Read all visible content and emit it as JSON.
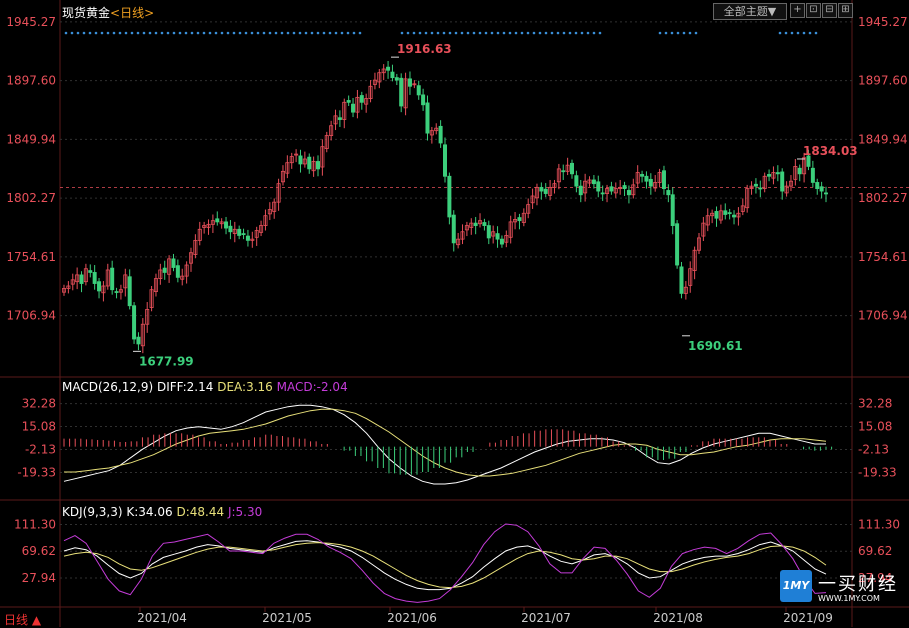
{
  "header": {
    "symbol": "现货黄金",
    "period_tag": "<日线>",
    "theme_button": "全部主题▼"
  },
  "window_buttons": [
    "+",
    "⊡",
    "⊟",
    "⊞"
  ],
  "period_label": "日线 ▲",
  "watermark": {
    "logo_text": "1MY",
    "name": "一买财经",
    "url": "WWW.1MY.COM"
  },
  "colors": {
    "up": "#e8505a",
    "down": "#3ccf7c",
    "axis_text": "#e8505a",
    "grid": "#303030",
    "diff": "#ffffff",
    "dea": "#e8e07a",
    "k": "#ffffff",
    "d": "#e8e07a",
    "j": "#c43cd8"
  },
  "chart_data": [
    {
      "type": "candlestick",
      "title": "现货黄金",
      "yticks": [
        "1945.27",
        "1897.60",
        "1849.94",
        "1802.27",
        "1754.61",
        "1706.94"
      ],
      "ylim": [
        1658,
        1950
      ],
      "xticks": [
        "2021/04",
        "2021/05",
        "2021/06",
        "2021/07",
        "2021/08",
        "2021/09"
      ],
      "annotations": [
        {
          "text": "1916.63",
          "value": 1916.63,
          "type": "high"
        },
        {
          "text": "1677.99",
          "value": 1677.99,
          "type": "low"
        },
        {
          "text": "1690.61",
          "value": 1690.61,
          "type": "low"
        },
        {
          "text": "1834.03",
          "value": 1834.03,
          "type": "high"
        }
      ],
      "reference_line": 1811,
      "closes": [
        1729,
        1731,
        1736,
        1740,
        1733,
        1745,
        1742,
        1733,
        1727,
        1731,
        1744,
        1728,
        1726,
        1728,
        1740,
        1715,
        1688,
        1684,
        1700,
        1712,
        1728,
        1737,
        1744,
        1742,
        1753,
        1746,
        1738,
        1739,
        1748,
        1758,
        1768,
        1777,
        1780,
        1781,
        1784,
        1783,
        1783,
        1778,
        1775,
        1777,
        1772,
        1773,
        1768,
        1769,
        1776,
        1780,
        1788,
        1793,
        1799,
        1814,
        1824,
        1831,
        1836,
        1838,
        1830,
        1834,
        1826,
        1832,
        1826,
        1844,
        1853,
        1861,
        1869,
        1866,
        1880,
        1880,
        1872,
        1884,
        1880,
        1883,
        1893,
        1898,
        1904,
        1907,
        1906,
        1900,
        1898,
        1877,
        1899,
        1893,
        1895,
        1886,
        1878,
        1855,
        1857,
        1859,
        1847,
        1820,
        1787,
        1766,
        1769,
        1775,
        1780,
        1782,
        1780,
        1784,
        1780,
        1770,
        1775,
        1769,
        1765,
        1772,
        1783,
        1785,
        1784,
        1790,
        1797,
        1804,
        1811,
        1808,
        1806,
        1811,
        1814,
        1826,
        1824,
        1829,
        1822,
        1812,
        1805,
        1816,
        1817,
        1814,
        1808,
        1806,
        1810,
        1808,
        1810,
        1811,
        1810,
        1805,
        1813,
        1823,
        1820,
        1816,
        1812,
        1815,
        1823,
        1810,
        1805,
        1780,
        1748,
        1725,
        1730,
        1745,
        1760,
        1770,
        1782,
        1788,
        1790,
        1786,
        1792,
        1789,
        1790,
        1787,
        1790,
        1796,
        1810,
        1812,
        1812,
        1810,
        1820,
        1820,
        1823,
        1822,
        1808,
        1812,
        1816,
        1828,
        1822,
        1835,
        1828,
        1815,
        1810,
        1808,
        1806
      ],
      "highs_marked": [
        1916.63,
        1834.03
      ],
      "lows_marked": [
        1677.99,
        1690.61
      ]
    },
    {
      "type": "line",
      "title": "MACD(26,12,9)",
      "labels": {
        "name": "MACD(26,12,9)",
        "diff": "DIFF:2.14",
        "dea": "DEA:3.16",
        "macd": "MACD:-2.04"
      },
      "yticks": [
        "32.28",
        "15.08",
        "-2.13",
        "-19.33"
      ],
      "ylim": [
        -37,
        38
      ],
      "series": [
        {
          "name": "DIFF",
          "values": [
            -26,
            -24,
            -22,
            -20,
            -18,
            -14,
            -8,
            -2,
            3,
            8,
            12,
            14,
            15,
            14,
            13,
            15,
            18,
            22,
            26,
            28,
            30,
            31,
            31,
            30,
            28,
            24,
            18,
            10,
            0,
            -9,
            -16,
            -22,
            -26,
            -28,
            -28,
            -27,
            -25,
            -22,
            -19,
            -16,
            -12,
            -8,
            -4,
            -1,
            2,
            4,
            5,
            6,
            6,
            5,
            3,
            -1,
            -7,
            -12,
            -13,
            -10,
            -5,
            -1,
            2,
            4,
            6,
            8,
            10,
            10,
            8,
            6,
            4,
            2,
            2
          ]
        },
        {
          "name": "DEA",
          "values": [
            -19,
            -19,
            -18,
            -17,
            -16,
            -14,
            -12,
            -9,
            -6,
            -2,
            2,
            5,
            8,
            10,
            11,
            12,
            13,
            15,
            17,
            20,
            23,
            25,
            27,
            28,
            28,
            27,
            25,
            21,
            16,
            11,
            5,
            -1,
            -7,
            -12,
            -16,
            -19,
            -21,
            -22,
            -22,
            -21,
            -20,
            -18,
            -16,
            -14,
            -11,
            -8,
            -5,
            -3,
            -1,
            1,
            2,
            2,
            1,
            -2,
            -4,
            -6,
            -6,
            -5,
            -4,
            -2,
            0,
            1,
            3,
            5,
            6,
            6,
            6,
            5,
            4
          ]
        },
        {
          "name": "MACD",
          "values": [
            12,
            12,
            11,
            10,
            9,
            7,
            8,
            14,
            18,
            20,
            20,
            18,
            14,
            8,
            4,
            6,
            10,
            14,
            18,
            16,
            14,
            12,
            8,
            4,
            0,
            -6,
            -14,
            -22,
            -32,
            -40,
            -42,
            -42,
            -38,
            -32,
            -24,
            -16,
            -8,
            0,
            6,
            10,
            16,
            20,
            24,
            26,
            26,
            24,
            20,
            18,
            14,
            8,
            2,
            -6,
            -16,
            -20,
            -18,
            -8,
            2,
            8,
            12,
            12,
            12,
            14,
            14,
            10,
            4,
            0,
            -4,
            -6,
            -4
          ]
        }
      ]
    },
    {
      "type": "line",
      "title": "KDJ(9,3,3)",
      "labels": {
        "name": "KDJ(9,3,3)",
        "k": "K:34.06",
        "d": "D:48.44",
        "j": "J:5.30"
      },
      "yticks": [
        "111.30",
        "69.62",
        "27.94"
      ],
      "ylim": [
        -14,
        126
      ],
      "series": [
        {
          "name": "K",
          "values": [
            70,
            75,
            72,
            62,
            48,
            35,
            28,
            35,
            50,
            60,
            65,
            70,
            76,
            80,
            78,
            74,
            72,
            70,
            68,
            75,
            80,
            85,
            86,
            84,
            80,
            76,
            70,
            60,
            48,
            36,
            26,
            18,
            12,
            10,
            10,
            12,
            20,
            30,
            45,
            58,
            70,
            76,
            78,
            72,
            62,
            54,
            50,
            56,
            64,
            66,
            60,
            50,
            36,
            28,
            30,
            40,
            50,
            56,
            60,
            62,
            62,
            66,
            72,
            80,
            84,
            78,
            70,
            56,
            42,
            34
          ]
        },
        {
          "name": "D",
          "values": [
            62,
            66,
            68,
            66,
            60,
            50,
            42,
            40,
            44,
            50,
            56,
            62,
            68,
            73,
            76,
            76,
            74,
            72,
            70,
            72,
            76,
            80,
            82,
            83,
            82,
            80,
            76,
            70,
            62,
            52,
            42,
            32,
            24,
            18,
            14,
            13,
            15,
            20,
            28,
            38,
            48,
            58,
            66,
            70,
            68,
            64,
            58,
            56,
            58,
            62,
            62,
            58,
            50,
            42,
            38,
            38,
            42,
            48,
            53,
            57,
            60,
            62,
            66,
            72,
            77,
            78,
            76,
            70,
            60,
            48
          ]
        },
        {
          "name": "J",
          "values": [
            86,
            94,
            82,
            54,
            26,
            8,
            2,
            26,
            62,
            82,
            84,
            88,
            92,
            96,
            84,
            70,
            70,
            68,
            66,
            82,
            90,
            96,
            96,
            88,
            76,
            68,
            58,
            40,
            20,
            4,
            -4,
            -8,
            -10,
            -8,
            -4,
            10,
            30,
            52,
            80,
            100,
            112,
            110,
            100,
            78,
            50,
            36,
            36,
            58,
            76,
            74,
            56,
            34,
            8,
            -2,
            12,
            46,
            66,
            72,
            76,
            74,
            66,
            74,
            86,
            96,
            98,
            80,
            58,
            28,
            4,
            5.3
          ]
        }
      ]
    }
  ]
}
